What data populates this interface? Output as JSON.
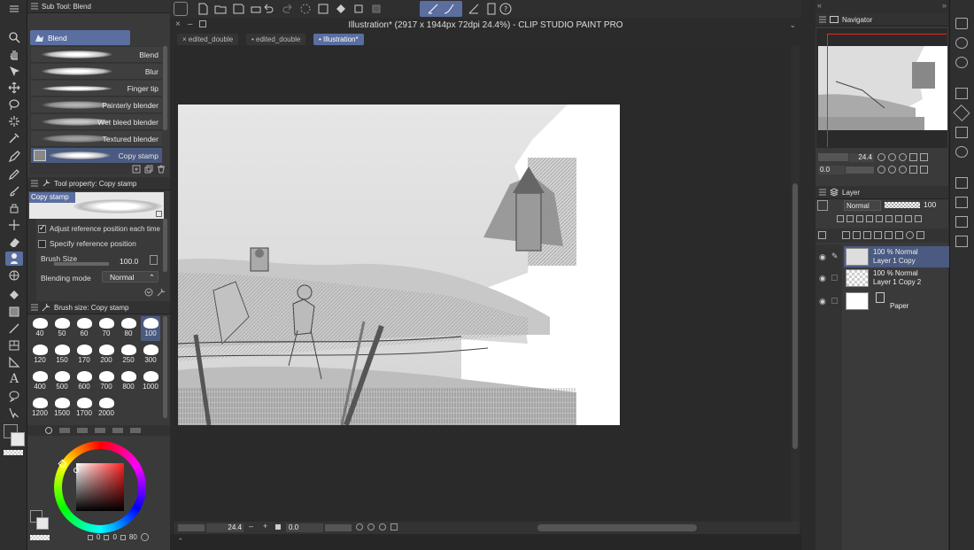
{
  "app": {
    "title": "Illustration* (2917 x 1944px 72dpi 24.4%)  - CLIP STUDIO PAINT PRO",
    "tabs": [
      "edited_double",
      "edited_double",
      "Illustration*"
    ]
  },
  "subtool": {
    "header": "Sub Tool: Blend",
    "group": "Blend",
    "items": [
      "Blend",
      "Blur",
      "Finger tip",
      "Painterly blender",
      "Wet bleed blender",
      "Textured blender",
      "Copy stamp"
    ]
  },
  "toolprop": {
    "header": "Tool property: Copy stamp",
    "preview_label": "Copy stamp",
    "adjust_label": "Adjust reference position each time",
    "specify_label": "Specify reference position",
    "brush_size_label": "Brush Size",
    "brush_size_value": "100.0",
    "blending_label": "Blending mode",
    "blending_value": "Normal"
  },
  "brushsize": {
    "header": "Brush size: Copy stamp",
    "sizes": [
      "40",
      "50",
      "60",
      "70",
      "80",
      "100",
      "120",
      "150",
      "170",
      "200",
      "250",
      "300",
      "400",
      "500",
      "600",
      "700",
      "800",
      "1000",
      "1200",
      "1500",
      "1700",
      "2000"
    ],
    "selected": "100"
  },
  "color": {
    "hue_marker": "#ff2020",
    "status_a": "0",
    "status_b": "0",
    "status_c": "80"
  },
  "canvas": {
    "zoom": "24.4",
    "rotation": "0.0"
  },
  "navigator": {
    "header": "Navigator",
    "zoom": "24.4",
    "rotation": "0.0"
  },
  "layer": {
    "header": "Layer",
    "blend_mode": "Normal",
    "opacity": "100",
    "layers": [
      {
        "mode": "100 % Normal",
        "name": "Layer 1 Copy",
        "selected": true
      },
      {
        "mode": "100 % Normal",
        "name": "Layer 1 Copy 2",
        "selected": false
      },
      {
        "mode": "",
        "name": "Paper",
        "selected": false
      }
    ]
  },
  "colors": {
    "accent": "#5a6ea0",
    "panel": "#3a3a3a",
    "background": "#2b2b2b"
  }
}
